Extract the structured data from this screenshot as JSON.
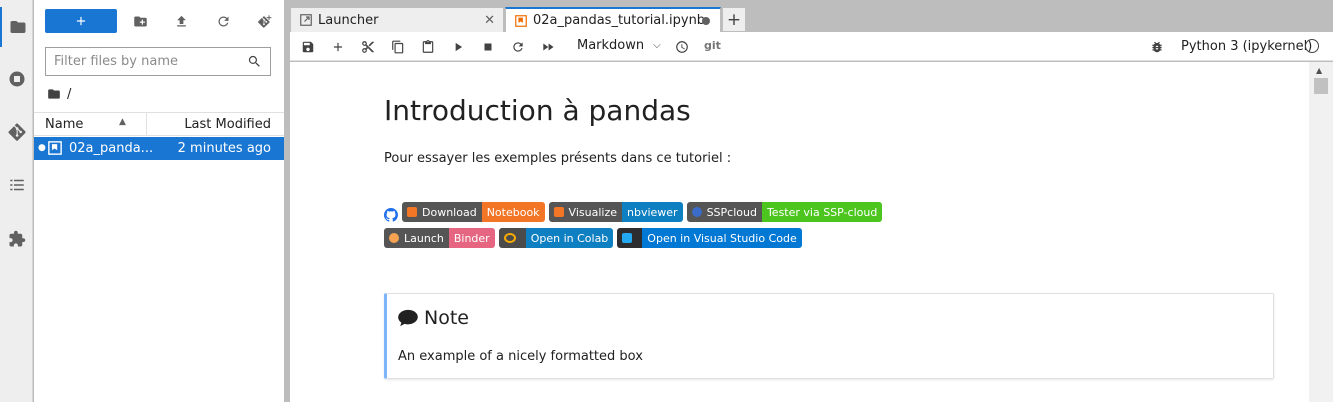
{
  "activity_bar": {
    "items": [
      "folder-icon",
      "running-icon",
      "git-icon",
      "toc-icon",
      "extension-icon"
    ]
  },
  "file_browser": {
    "toolbar": [
      "new-launcher",
      "new-folder",
      "upload",
      "refresh",
      "git-clone"
    ],
    "filter_placeholder": "Filter files by name",
    "breadcrumb": "/",
    "columns": {
      "name": "Name",
      "modified": "Last Modified"
    },
    "files": [
      {
        "name": "02a_panda...",
        "modified": "2 minutes ago",
        "selected": true
      }
    ]
  },
  "tabs": [
    {
      "label": "Launcher",
      "active": false
    },
    {
      "label": "02a_pandas_tutorial.ipynb",
      "active": true,
      "dirty": true
    }
  ],
  "notebook_toolbar": {
    "cell_type": "Markdown",
    "git_label": "git",
    "kernel": "Python 3 (ipykernel)"
  },
  "notebook": {
    "title": "Introduction à pandas",
    "intro": "Pour essayer les exemples présents dans ce tutoriel :",
    "badges_row1": [
      {
        "left": "Download",
        "right": "Notebook",
        "right_color": "#f37626",
        "logo_color": "#f37626"
      },
      {
        "left": "Visualize",
        "right": "nbviewer",
        "right_color": "#0e7fc0",
        "logo_color": "#f37626"
      },
      {
        "left": "SSPcloud",
        "right": "Tester via SSP-cloud",
        "right_color": "#4cc61e",
        "logo_color": "#3b6cc9"
      }
    ],
    "badges_row2": [
      {
        "left": "Launch",
        "right": "Binder",
        "right_color": "#e66581",
        "logo_color": "#f5a252"
      },
      {
        "single": "Open in Colab",
        "bg": "#4b4b4b",
        "logo_color": "#f9ab00",
        "accent": "#0e7fc0"
      },
      {
        "single": "Open in Visual Studio Code",
        "bg": "#0078d4",
        "logo_color": "#23a9f2"
      }
    ],
    "note": {
      "title": "Note",
      "body": "An example of a nicely formatted box"
    }
  },
  "colors": {
    "accent": "#1976d2",
    "note_border": "#7fb4ff"
  }
}
